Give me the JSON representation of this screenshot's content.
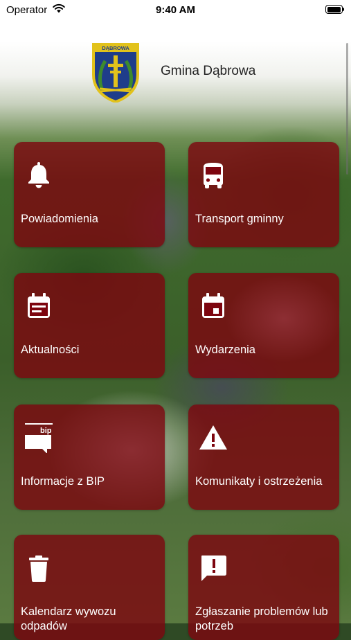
{
  "status_bar": {
    "carrier": "Operator",
    "time": "9:40 AM"
  },
  "header": {
    "crest_text": "DĄBROWA",
    "title": "Gmina Dąbrowa"
  },
  "colors": {
    "tile_bg": "#7d050f",
    "tile_text": "#ffffff",
    "crest_blue": "#1f3d8a",
    "crest_gold": "#e2c21b"
  },
  "tiles": [
    {
      "label": "Powiadomienia",
      "icon": "bell-icon"
    },
    {
      "label": "Transport gminny",
      "icon": "bus-icon"
    },
    {
      "label": "Aktualności",
      "icon": "news-calendar-icon"
    },
    {
      "label": "Wydarzenia",
      "icon": "event-calendar-icon"
    },
    {
      "label": "Informacje z BIP",
      "icon": "bip-icon",
      "icon_text": "bip"
    },
    {
      "label": "Komunikaty i ostrzeżenia",
      "icon": "warning-icon"
    },
    {
      "label": "Kalendarz wywozu odpadów",
      "icon": "trash-icon"
    },
    {
      "label": "Zgłaszanie problemów lub potrzeb",
      "icon": "report-problem-icon"
    }
  ]
}
